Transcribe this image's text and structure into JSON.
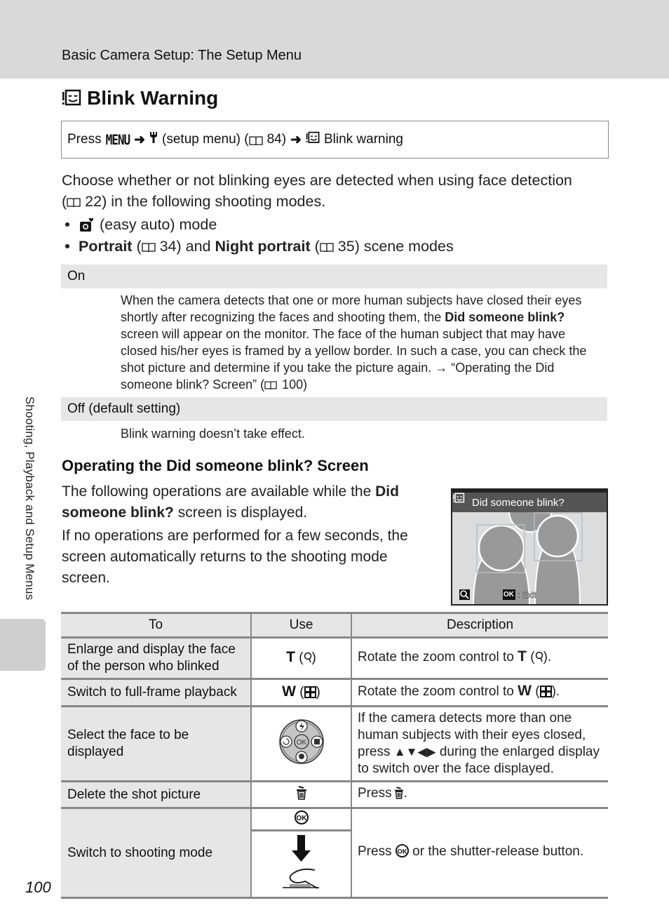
{
  "header": {
    "section_title": "Basic Camera Setup: The Setup Menu"
  },
  "title": {
    "icon": "blink-warning-icon",
    "text": "Blink Warning"
  },
  "press_path": {
    "press": "Press",
    "menu_button": "MENU",
    "setup_icon": "wrench-icon",
    "setup_label": "(setup menu) (",
    "setup_page": "84)",
    "item_icon": "blink-warning-icon",
    "item_label": "Blink warning"
  },
  "intro": {
    "line1": "Choose whether or not blinking eyes are detected when using face detection",
    "line2_open": "(",
    "line2_page": "22) in the following shooting modes.",
    "bullets": [
      {
        "icon": "easy-auto-icon",
        "text": "(easy auto) mode"
      },
      {
        "bold1": "Portrait",
        "ref1_open": " (",
        "ref1_page": "34) and ",
        "bold2": "Night portrait",
        "ref2_open": " (",
        "ref2_page": "35) scene modes"
      }
    ]
  },
  "options": [
    {
      "label": "On",
      "desc_part1": "When the camera detects that one or more human subjects have closed their eyes shortly after recognizing the faces and shooting them, the ",
      "desc_bold": "Did someone blink?",
      "desc_part2": " screen will appear on the monitor. The face of the human subject that may have closed his/her eyes is framed by a yellow border. In such a case, you can check the shot picture and determine if you take the picture again. → “Operating the Did someone blink? Screen” (",
      "desc_page": "100)"
    },
    {
      "label": "Off (default setting)",
      "desc": "Blink warning doesn’t take effect."
    }
  ],
  "operating": {
    "heading": "Operating the Did someone blink? Screen",
    "para1_a": "The following operations are available while the ",
    "para1_bold": "Did someone blink?",
    "para1_b": " screen is displayed.",
    "para2": "If no operations are performed for a few seconds, the screen automatically returns to the shooting mode screen."
  },
  "camera_screen": {
    "title": "Did someone blink?",
    "ok_label": "OK",
    "exit_label": ": Exit"
  },
  "side_tab": {
    "text": "Shooting, Playback and Setup Menus"
  },
  "table": {
    "headers": [
      "To",
      "Use",
      "Description"
    ],
    "rows": [
      {
        "to": "Enlarge and display the face of the person who blinked",
        "use_letter": "T",
        "use_icon": "zoom-in-icon",
        "desc": "Rotate the zoom control to",
        "desc_letter": "T"
      },
      {
        "to": "Switch to full-frame playback",
        "use_letter": "W",
        "use_icon": "thumbnail-icon",
        "desc": "Rotate the zoom control to",
        "desc_letter": "W"
      },
      {
        "to": "Select the face to be displayed",
        "use_icon": "multi-selector-icon",
        "desc_a": "If the camera detects more than one human subjects with their eyes closed, press",
        "desc_arrows": "▲▼◀▶",
        "desc_b": "during the enlarged display to switch over the face displayed."
      },
      {
        "to": "Delete the shot picture",
        "use_icon": "trash-icon",
        "desc": "Press"
      },
      {
        "to": "Switch to shooting mode",
        "use_icon_1": "ok-button-icon",
        "use_icon_2": "shutter-release-icon",
        "desc_a": "Press",
        "desc_b": "or the shutter-release button."
      }
    ]
  },
  "page_number": "100"
}
